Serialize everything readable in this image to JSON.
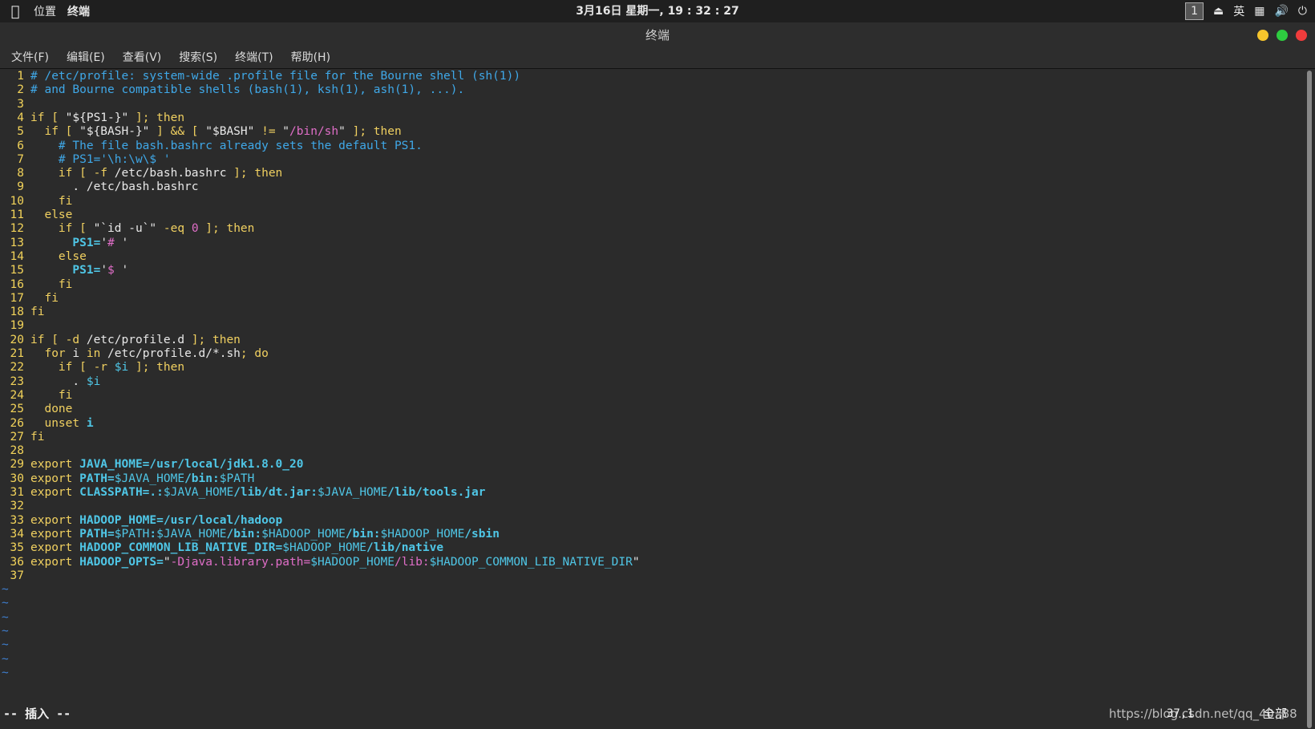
{
  "topbar": {
    "apple": "",
    "menu_places": "位置",
    "menu_terminal": "终端",
    "clock": "3月16日 星期一, 19 : 32 : 27",
    "workspace": "1",
    "ime": "英"
  },
  "window": {
    "title": "终端",
    "buttons": {
      "minimize_color": "#f5c42c",
      "maximize_color": "#2ecc40",
      "close_color": "#f03c3c"
    }
  },
  "menu": [
    "文件(F)",
    "编辑(E)",
    "查看(V)",
    "搜索(S)",
    "终端(T)",
    "帮助(H)"
  ],
  "lines": [
    [
      [
        "cm",
        "# /etc/profile: system-wide .profile file for the Bourne shell (sh(1))"
      ]
    ],
    [
      [
        "cm",
        "# and Bourne compatible shells (bash(1), ksh(1), ash(1), ...)."
      ]
    ],
    [],
    [
      [
        "kw",
        "if [ "
      ],
      [
        "plain",
        "\"${PS1-}\""
      ],
      [
        "kw",
        " ]; then"
      ]
    ],
    [
      [
        "kw",
        "  if [ "
      ],
      [
        "plain",
        "\"${BASH-}\""
      ],
      [
        "kw",
        " ] && [ "
      ],
      [
        "plain",
        "\"$BASH\""
      ],
      [
        "kw",
        " != "
      ],
      [
        "plain",
        "\""
      ],
      [
        "str",
        "/bin/sh"
      ],
      [
        "plain",
        "\""
      ],
      [
        "kw",
        " ]; then"
      ]
    ],
    [
      [
        "cm",
        "    # The file bash.bashrc already sets the default PS1."
      ]
    ],
    [
      [
        "cm",
        "    # PS1='\\h:\\w\\$ '"
      ]
    ],
    [
      [
        "kw",
        "    if [ -f "
      ],
      [
        "plain",
        "/etc/bash.bashrc"
      ],
      [
        "kw",
        " ]; then"
      ]
    ],
    [
      [
        "plain",
        "      . /etc/bash.bashrc"
      ]
    ],
    [
      [
        "kw",
        "    fi"
      ]
    ],
    [
      [
        "kw",
        "  else"
      ]
    ],
    [
      [
        "kw",
        "    if [ "
      ],
      [
        "plain",
        "\"`id -u`\""
      ],
      [
        "kw",
        " -eq "
      ],
      [
        "str",
        "0"
      ],
      [
        "kw",
        " ]; then"
      ]
    ],
    [
      [
        "bvar",
        "      PS1="
      ],
      [
        "plain",
        "'"
      ],
      [
        "str",
        "# "
      ],
      [
        "plain",
        "'"
      ]
    ],
    [
      [
        "kw",
        "    else"
      ]
    ],
    [
      [
        "bvar",
        "      PS1="
      ],
      [
        "plain",
        "'"
      ],
      [
        "str",
        "$ "
      ],
      [
        "plain",
        "'"
      ]
    ],
    [
      [
        "kw",
        "    fi"
      ]
    ],
    [
      [
        "kw",
        "  fi"
      ]
    ],
    [
      [
        "kw",
        "fi"
      ]
    ],
    [],
    [
      [
        "kw",
        "if [ -d "
      ],
      [
        "plain",
        "/etc/profile.d"
      ],
      [
        "kw",
        " ]; then"
      ]
    ],
    [
      [
        "kw",
        "  for "
      ],
      [
        "plain",
        "i"
      ],
      [
        "kw",
        " in "
      ],
      [
        "plain",
        "/etc/profile.d/*.sh"
      ],
      [
        "kw",
        "; do"
      ]
    ],
    [
      [
        "kw",
        "    if [ -r "
      ],
      [
        "var",
        "$i"
      ],
      [
        "kw",
        " ]; then"
      ]
    ],
    [
      [
        "plain",
        "      . "
      ],
      [
        "var",
        "$i"
      ]
    ],
    [
      [
        "kw",
        "    fi"
      ]
    ],
    [
      [
        "kw",
        "  done"
      ]
    ],
    [
      [
        "kw",
        "  unset "
      ],
      [
        "bvar",
        "i"
      ]
    ],
    [
      [
        "kw",
        "fi"
      ]
    ],
    [],
    [
      [
        "kw",
        "export "
      ],
      [
        "bvar",
        "JAVA_HOME=/usr/local/jdk1.8.0_20"
      ]
    ],
    [
      [
        "kw",
        "export "
      ],
      [
        "bvar",
        "PATH="
      ],
      [
        "var",
        "$JAVA_HOME"
      ],
      [
        "bvar",
        "/bin:"
      ],
      [
        "var",
        "$PATH"
      ]
    ],
    [
      [
        "kw",
        "export "
      ],
      [
        "bvar",
        "CLASSPATH=.:"
      ],
      [
        "var",
        "$JAVA_HOME"
      ],
      [
        "bvar",
        "/lib/dt.jar:"
      ],
      [
        "var",
        "$JAVA_HOME"
      ],
      [
        "bvar",
        "/lib/tools.jar"
      ]
    ],
    [],
    [
      [
        "kw",
        "export "
      ],
      [
        "bvar",
        "HADOOP_HOME=/usr/local/hadoop"
      ]
    ],
    [
      [
        "kw",
        "export "
      ],
      [
        "bvar",
        "PATH="
      ],
      [
        "var",
        "$PATH"
      ],
      [
        "bvar",
        ":"
      ],
      [
        "var",
        "$JAVA_HOME"
      ],
      [
        "bvar",
        "/bin:"
      ],
      [
        "var",
        "$HADOOP_HOME"
      ],
      [
        "bvar",
        "/bin:"
      ],
      [
        "var",
        "$HADOOP_HOME"
      ],
      [
        "bvar",
        "/sbin"
      ]
    ],
    [
      [
        "kw",
        "export "
      ],
      [
        "bvar",
        "HADOOP_COMMON_LIB_NATIVE_DIR="
      ],
      [
        "var",
        "$HADOOP_HOME"
      ],
      [
        "bvar",
        "/lib/native"
      ]
    ],
    [
      [
        "kw",
        "export "
      ],
      [
        "bvar",
        "HADOOP_OPTS="
      ],
      [
        "plain",
        "\""
      ],
      [
        "str",
        "-Djava.library.path="
      ],
      [
        "var",
        "$HADOOP_HOME"
      ],
      [
        "str",
        "/lib:"
      ],
      [
        "var",
        "$HADOOP_COMMON_LIB_NATIVE_DIR"
      ],
      [
        "plain",
        "\""
      ]
    ],
    []
  ],
  "tildes": [
    "~",
    "~",
    "~",
    "~",
    "~",
    "~",
    "~"
  ],
  "status": {
    "mode": "-- 插入 --",
    "position": "37,1",
    "scroll": "全部"
  },
  "watermark": "https://blog.csdn.net/qq_40..88"
}
